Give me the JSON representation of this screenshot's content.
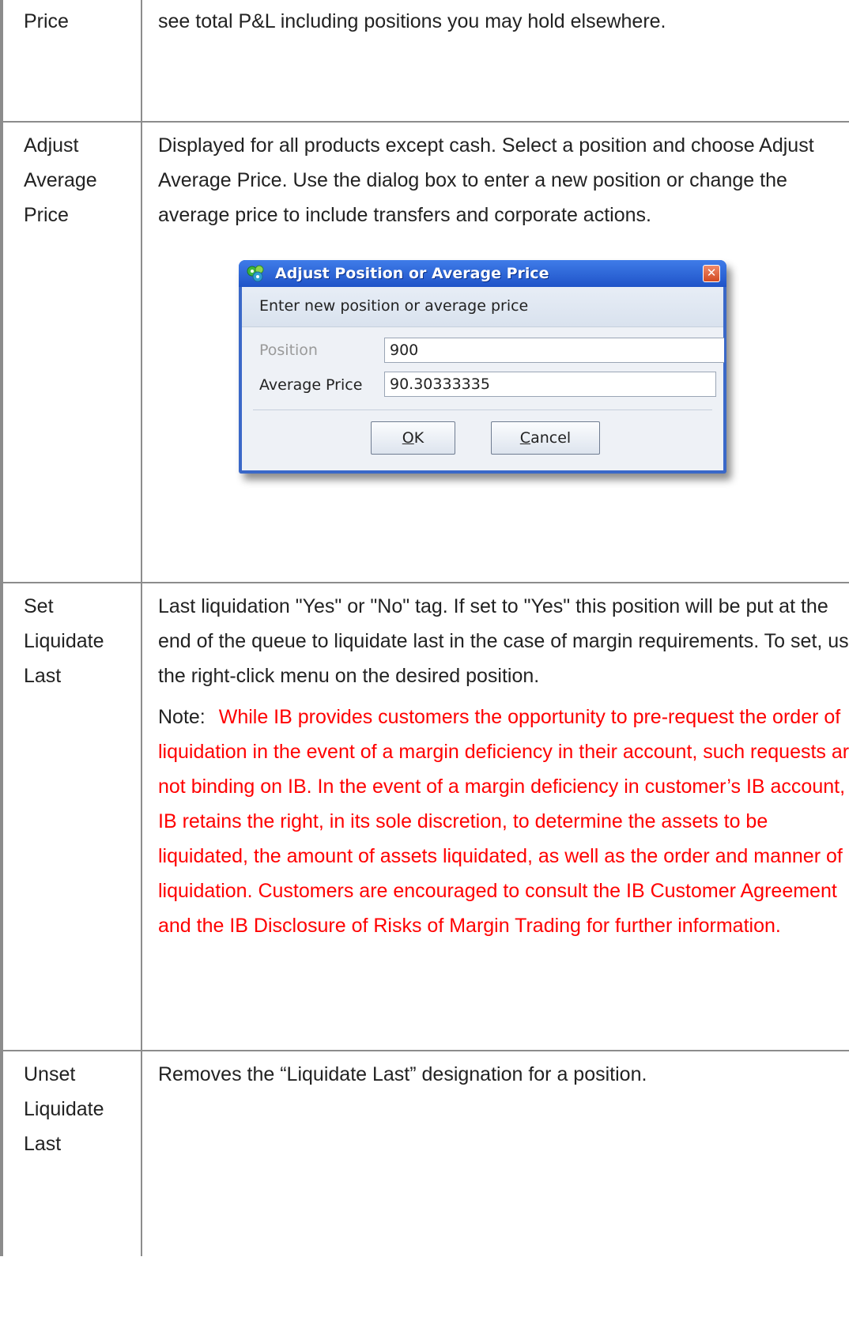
{
  "rows": [
    {
      "term_lines": [
        "Price"
      ],
      "desc": "see total P&L including positions you may hold elsewhere."
    },
    {
      "term_lines": [
        "Adjust",
        "Average",
        "Price"
      ],
      "desc": "Displayed for all products except cash. Select a position and choose Adjust Average Price. Use the dialog box to enter a new position or change the average price to include transfers and corporate actions."
    },
    {
      "term_lines": [
        "Set",
        "Liquidate",
        "Last"
      ],
      "desc": "Last liquidation \"Yes\" or \"No\" tag. If set to \"Yes\" this position will be put at the end of the queue to liquidate last in the case of margin requirements. To set, use the right-click menu on the desired position.",
      "note_label": "Note:",
      "note_text": "While IB provides customers the opportunity to pre-request the order of liquidation in the event of a margin deficiency in their account, such requests are not binding on IB. In the event of a margin deficiency in customer’s IB account, IB retains the right, in its sole discretion, to determine the assets to be liquidated, the amount of assets liquidated, as well as the order and manner of liquidation. Customers are encouraged to consult the IB Customer Agreement and the IB Disclosure of Risks of Margin Trading for further information."
    },
    {
      "term_lines": [
        "Unset",
        "Liquidate",
        "Last"
      ],
      "desc": "Removes the “Liquidate Last” designation for a position."
    }
  ],
  "dialog": {
    "title": "Adjust Position or Average Price",
    "close_icon": "close-icon",
    "app_icon": "app-logo-icon",
    "prompt": "Enter new position or average price",
    "position_label": "Position",
    "position_value": "900",
    "avg_label": "Average Price",
    "avg_value": "90.30333335",
    "ok_mnemonic": "O",
    "ok_rest": "K",
    "cancel_mnemonic": "C",
    "cancel_rest": "ancel"
  },
  "colors": {
    "note_text": "#ff0000",
    "border": "#8c8c8c",
    "dialog_title_bar": "#2a60d8"
  }
}
